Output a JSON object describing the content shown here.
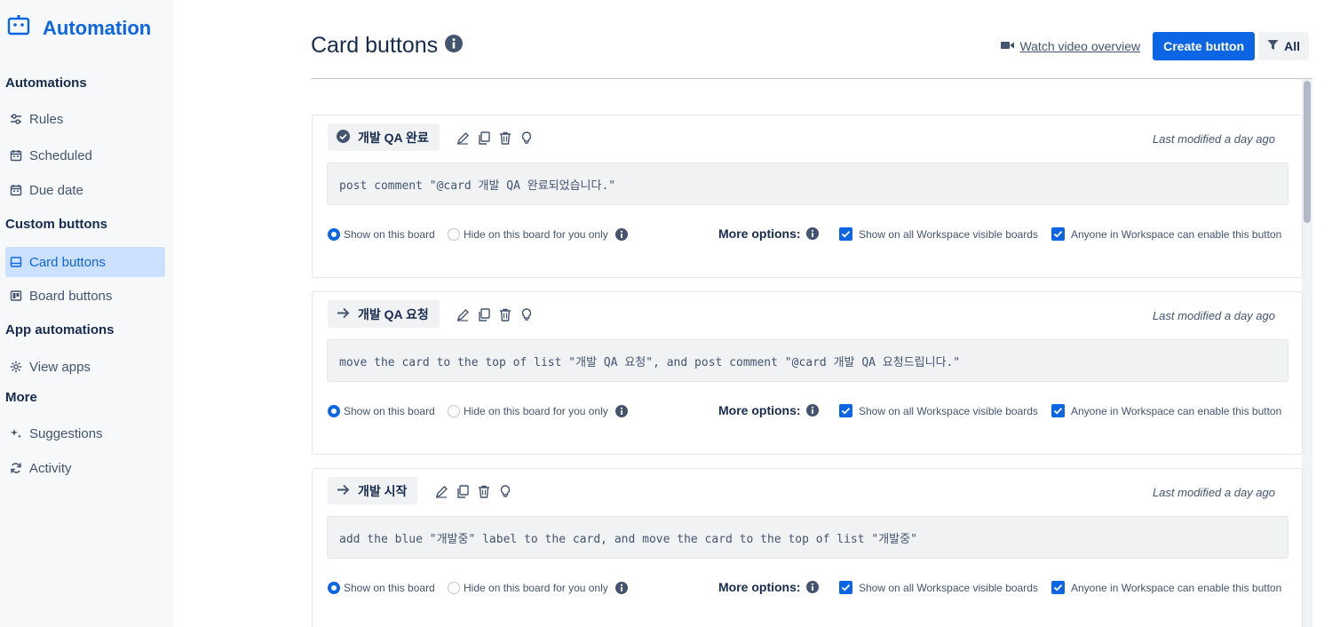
{
  "sidebar": {
    "title": "Automation",
    "sections": [
      {
        "heading": "Automations",
        "items": [
          {
            "label": "Rules",
            "icon": "sliders-icon"
          },
          {
            "label": "Scheduled",
            "icon": "calendar-icon"
          },
          {
            "label": "Due date",
            "icon": "calendar-icon"
          }
        ]
      },
      {
        "heading": "Custom buttons",
        "items": [
          {
            "label": "Card buttons",
            "icon": "card-icon",
            "active": true
          },
          {
            "label": "Board buttons",
            "icon": "board-icon"
          }
        ]
      },
      {
        "heading": "App automations",
        "items": [
          {
            "label": "View apps",
            "icon": "gear-icon"
          }
        ]
      },
      {
        "heading": "More",
        "items": [
          {
            "label": "Suggestions",
            "icon": "sparkle-icon"
          },
          {
            "label": "Activity",
            "icon": "refresh-icon"
          }
        ]
      }
    ]
  },
  "header": {
    "title": "Card buttons",
    "video_link": "Watch video overview",
    "create_button": "Create button",
    "filter_button": "All"
  },
  "common": {
    "show_board": "Show on this board",
    "hide_board": "Hide on this board for you only",
    "more_options": "More options:",
    "show_all": "Show on all Workspace visible boards",
    "anyone_enable": "Anyone in Workspace can enable this button"
  },
  "cards": [
    {
      "name": "개발 QA 완료",
      "icon": "check-circle-icon",
      "modified": "Last modified a day ago",
      "command": "post comment \"@card 개발 QA 완료되었습니다.\""
    },
    {
      "name": "개발 QA 요청",
      "icon": "arrow-right-icon",
      "modified": "Last modified a day ago",
      "command": "move the card to the top of list \"개발 QA 요청\", and post comment \"@card 개발 QA 요청드립니다.\""
    },
    {
      "name": "개발 시작",
      "icon": "arrow-right-icon",
      "modified": "Last modified a day ago",
      "command": "add the blue \"개발중\" label to the card, and move the card to the top of list \"개발중\""
    }
  ],
  "colors": {
    "accent": "#0c66e4",
    "sidebar_bg": "#f7f8f9",
    "active_bg": "#cce0ff"
  }
}
